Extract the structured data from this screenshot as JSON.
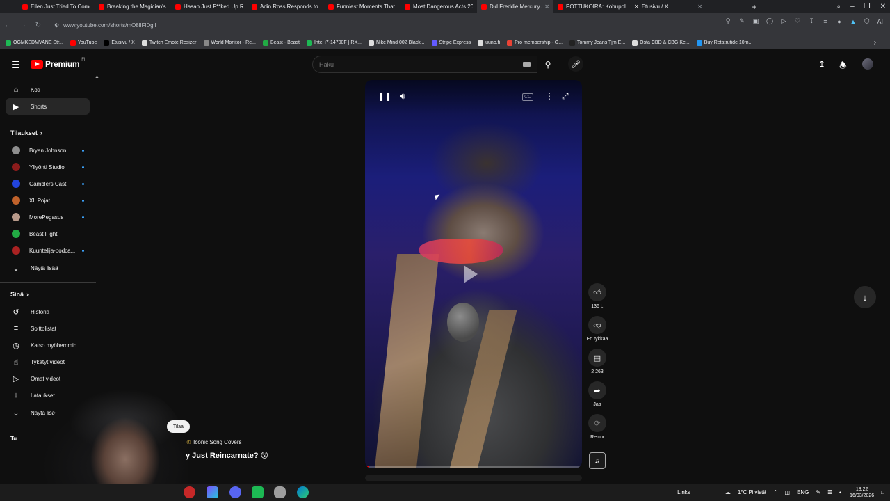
{
  "browser": {
    "tabs": [
      {
        "title": "Ellen Just Tried To Comeb",
        "active": false
      },
      {
        "title": "Breaking the Magician's C",
        "active": false
      },
      {
        "title": "Hasan Just F**ked Up Rea",
        "active": false
      },
      {
        "title": "Adin Ross Responds to Gy",
        "active": false
      },
      {
        "title": "Funniest Moments That M",
        "active": false
      },
      {
        "title": "Most Dangerous Acts 202",
        "active": false
      },
      {
        "title": "Did Freddie Mercury Just",
        "active": true
      },
      {
        "title": "POTTUKOIRA: Kohupoliitti",
        "active": false
      },
      {
        "title": "Etusivu / X",
        "active": false
      }
    ],
    "url": "www.youtube.com/shorts/mO8lIFlDgiI",
    "ai_label": "AI",
    "bookmarks": [
      {
        "label": "OGMKEDMVANE Str...",
        "color": "#1db954"
      },
      {
        "label": "YouTube",
        "color": "#ff0000"
      },
      {
        "label": "Etusivu / X",
        "color": "#000000"
      },
      {
        "label": "Twitch Emote Resizer",
        "color": "#dddddd"
      },
      {
        "label": "World Monitor - Re...",
        "color": "#888888"
      },
      {
        "label": "Beast - Beast",
        "color": "#22aa44"
      },
      {
        "label": "Intel i7-14700F | RX...",
        "color": "#1db954"
      },
      {
        "label": "Nike Mind 002 Black...",
        "color": "#dddddd"
      },
      {
        "label": "Stripe Express",
        "color": "#635bff"
      },
      {
        "label": "uuno.fi",
        "color": "#dddddd"
      },
      {
        "label": "Pro membership - G...",
        "color": "#ea4335"
      },
      {
        "label": "Tommy Jeans Tjm E...",
        "color": "#222222"
      },
      {
        "label": "Osta CBD & CBG Ke...",
        "color": "#dddddd"
      },
      {
        "label": "Buy Retatrutide 10m...",
        "color": "#2196f3"
      }
    ]
  },
  "youtube": {
    "logo_text": "Premium",
    "logo_region": "FI",
    "search_placeholder": "Haku",
    "sidebar": {
      "main": [
        {
          "label": "Koti",
          "icon": "home-icon"
        },
        {
          "label": "Shorts",
          "icon": "shorts-icon",
          "active": true
        }
      ],
      "subscriptions_header": "Tilaukset",
      "subscriptions": [
        {
          "label": "Bryan Johnson",
          "color": "#8e8e8e",
          "live": true
        },
        {
          "label": "Yllyönti Studio",
          "color": "#8b1c1c",
          "live": true
        },
        {
          "label": "Gämblers Cast",
          "color": "#2244dd",
          "live": true
        },
        {
          "label": "XL Pojat",
          "color": "#c0622b",
          "live": true
        },
        {
          "label": "MorePegasus",
          "color": "#b89a8a",
          "live": true
        },
        {
          "label": "Beast Fight",
          "color": "#22aa44",
          "live": false
        },
        {
          "label": "Kuuntelija-podca...",
          "color": "#aa2222",
          "live": true
        }
      ],
      "show_more_1": "Näytä lisää",
      "you_header": "Sinä",
      "you_items": [
        {
          "label": "Historia",
          "icon": "history-icon"
        },
        {
          "label": "Soittolistat",
          "icon": "playlist-icon"
        },
        {
          "label": "Katso myöhemmin",
          "icon": "clock-icon"
        },
        {
          "label": "Tykätyt videot",
          "icon": "thumb-up-icon"
        },
        {
          "label": "Omat videot",
          "icon": "video-icon"
        },
        {
          "label": "Lataukset",
          "icon": "download-icon"
        }
      ],
      "show_more_2": "Näytä lisää",
      "cut_header": "Tu"
    },
    "actions": {
      "like_count": "136 t.",
      "dislike_label": "En tykkää",
      "comments_count": "2 263",
      "share_label": "Jaa",
      "remix_label": "Remix"
    },
    "overlay": {
      "subscribe_label": "Tilaa",
      "channel_name": "Iconic Song Covers",
      "video_title": "y Just Reincarnate? 😲"
    },
    "progress_fraction": 0.02
  },
  "taskbar": {
    "links_label": "Links",
    "weather": "1°C  Pilvistä",
    "language": "ENG",
    "time": "18.22",
    "date": "16/03/2026"
  }
}
